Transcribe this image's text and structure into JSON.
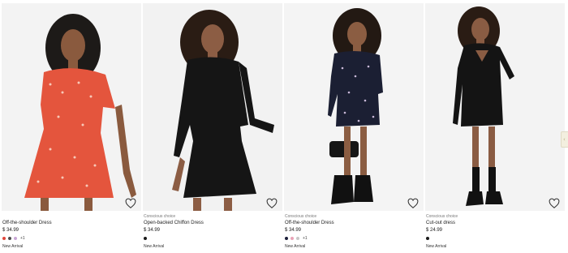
{
  "products": [
    {
      "tag": "",
      "name": "Off-the-shoulder Dress",
      "price": "$ 34.99",
      "colors": [
        "#e0463a",
        "#4b4b4b",
        "#c9a7d6"
      ],
      "more_colors": "+1",
      "badge": "New Arrival"
    },
    {
      "tag": "Conscious choice",
      "name": "Open-backed Chiffon Dress",
      "price": "$ 34.99",
      "colors": [
        "#1a1a1a"
      ],
      "more_colors": "",
      "badge": "New Arrival"
    },
    {
      "tag": "Conscious choice",
      "name": "Off-the-shoulder Dress",
      "price": "$ 34.99",
      "colors": [
        "#1c1f3a",
        "#e8a3b7",
        "#c7c7c7"
      ],
      "more_colors": "+1",
      "badge": "New Arrival"
    },
    {
      "tag": "Conscious choice",
      "name": "Cut-out dress",
      "price": "$ 24.99",
      "colors": [
        "#1a1a1a"
      ],
      "more_colors": "",
      "badge": "New Arrival"
    }
  ],
  "icons": {
    "favorite": "heart-outline-icon",
    "side_tab": "chevron-left-icon"
  },
  "side_tab_glyph": "‹"
}
